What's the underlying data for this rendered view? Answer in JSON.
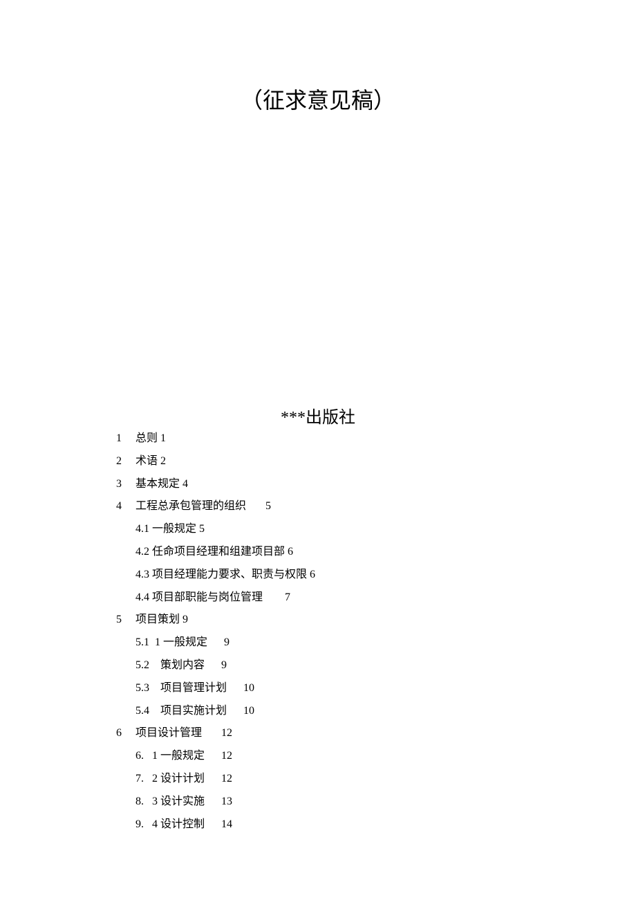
{
  "title": "（征求意见稿）",
  "publisher": "***出版社",
  "toc": [
    {
      "num": "1",
      "text": "总则 1"
    },
    {
      "num": "2",
      "text": "术语 2"
    },
    {
      "num": "3",
      "text": "基本规定 4"
    },
    {
      "num": "4",
      "text": "工程总承包管理的组织       5",
      "children": [
        {
          "text": "4.1 一般规定 5"
        },
        {
          "text": "4.2 任命项目经理和组建项目部 6"
        },
        {
          "text": "4.3 项目经理能力要求、职责与权限 6"
        },
        {
          "text": "4.4 项目部职能与岗位管理        7"
        }
      ]
    },
    {
      "num": "5",
      "text": "项目策划 9",
      "children": [
        {
          "text": "5.1  1 一般规定      9"
        },
        {
          "text": "5.2    策划内容      9"
        },
        {
          "text": "5.3    项目管理计划      10"
        },
        {
          "text": "5.4    项目实施计划      10"
        }
      ]
    },
    {
      "num": "6",
      "text": "项目设计管理       12",
      "children": [
        {
          "text": "6.   1 一般规定      12"
        },
        {
          "text": "7.   2 设计计划      12"
        },
        {
          "text": "8.   3 设计实施      13"
        },
        {
          "text": "9.   4 设计控制      14"
        }
      ]
    }
  ]
}
